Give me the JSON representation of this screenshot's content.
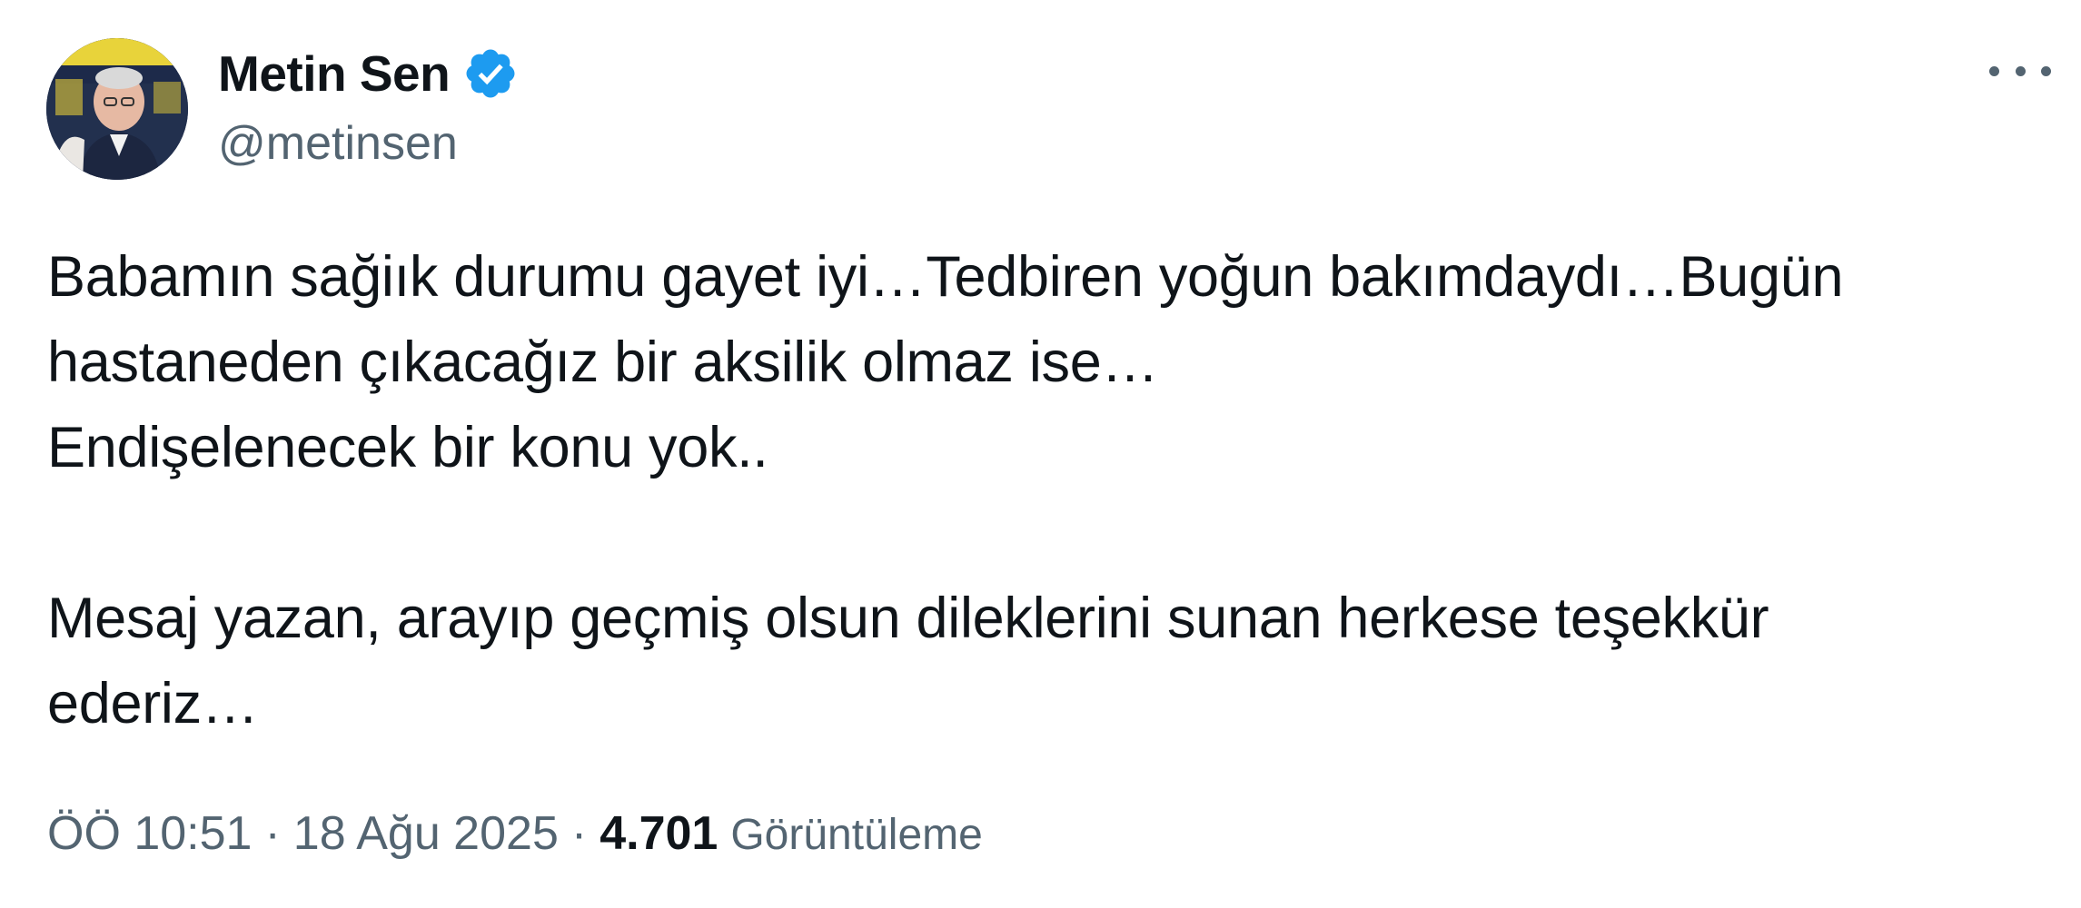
{
  "author": {
    "display_name": "Metin Sen",
    "handle": "@metinsen",
    "verified": true,
    "avatar": "profile-photo"
  },
  "more_icon": "ellipsis-icon",
  "tweet": {
    "lines": [
      "Babamın sağiık durumu gayet iyi…Tedbiren yoğun bakımdaydı…Bugün",
      "hastaneden çıkacağız bir aksilik olmaz ise…",
      "Endişelenecek bir konu yok..",
      "",
      "Mesaj yazan, arayıp geçmiş olsun dileklerini sunan herkese teşekkür",
      "ederiz…"
    ]
  },
  "meta": {
    "time": "ÖÖ 10:51",
    "separator": "·",
    "date": "18 Ağu 2025",
    "views_count": "4.701",
    "views_label": "Görüntüleme"
  },
  "colors": {
    "text_primary": "#0f1419",
    "text_secondary": "#536471",
    "verified_badge": "#1d9bf0",
    "background": "#ffffff"
  }
}
